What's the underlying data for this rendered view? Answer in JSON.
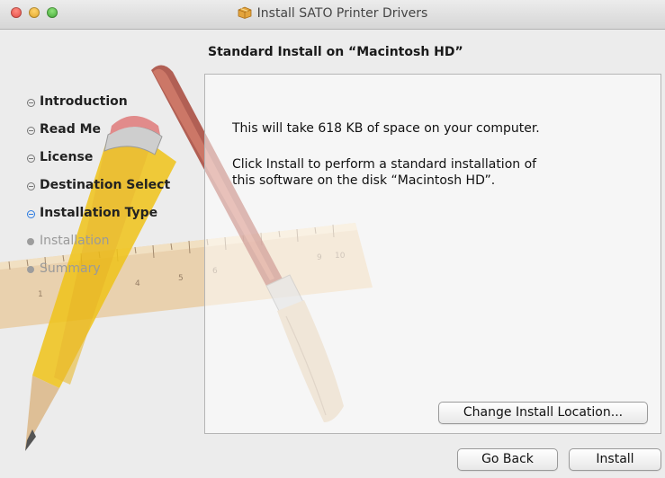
{
  "window": {
    "title": "Install SATO Printer Drivers",
    "title_icon": "package-icon"
  },
  "header": {
    "subtitle": "Standard Install on “Macintosh HD”"
  },
  "sidebar": {
    "steps": [
      {
        "label": "Introduction",
        "state": "done"
      },
      {
        "label": "Read Me",
        "state": "done"
      },
      {
        "label": "License",
        "state": "done"
      },
      {
        "label": "Destination Select",
        "state": "done"
      },
      {
        "label": "Installation Type",
        "state": "current"
      },
      {
        "label": "Installation",
        "state": "future"
      },
      {
        "label": "Summary",
        "state": "future"
      }
    ]
  },
  "panel": {
    "line1": "This will take 618 KB of space on your computer.",
    "line2": "Click Install to perform a standard installation of",
    "line3": "this software on the disk “Macintosh HD”."
  },
  "buttons": {
    "change_location": "Change Install Location...",
    "go_back": "Go Back",
    "install": "Install"
  },
  "artwork": {
    "ruler_numbers": [
      "1",
      "4",
      "5",
      "6",
      "9",
      "10"
    ]
  },
  "colors": {
    "current_step": "#2a7ae2",
    "window_bg": "#ececec"
  }
}
